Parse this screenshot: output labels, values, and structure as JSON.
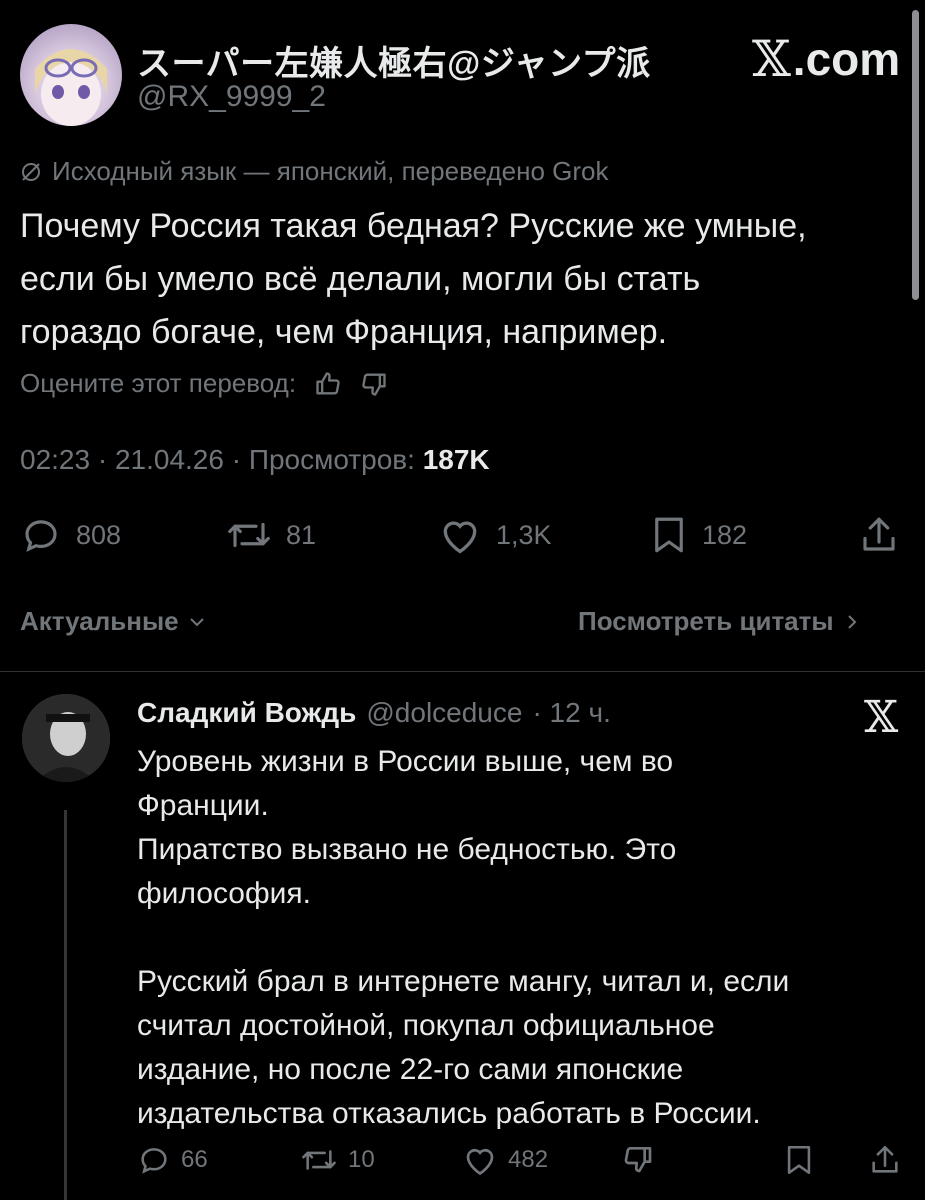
{
  "post": {
    "display_name": "スーパー左嫌人極右@ジャンプ派",
    "handle": "@RX_9999_2",
    "site_label": ".com",
    "translation_notice": "Исходный язык — японский, переведено Grok",
    "text": "Почему Россия такая бедная? Русские же умные,\nесли бы умело всё делали, могли бы стать\nгораздо богаче, чем Франция, например.",
    "rate_translation_label": "Оцените этот перевод:",
    "timestamp": "02:23 · 21.04.26 · ",
    "views_label": "Просмотров: ",
    "views_count": "187K",
    "actions": {
      "replies": "808",
      "reposts": "81",
      "likes": "1,3K",
      "bookmarks": "182"
    },
    "sort_label": "Актуальные",
    "quotes_label": "Посмотреть цитаты"
  },
  "reply": {
    "name": "Сладкий Вождь",
    "handle": "@dolceduce",
    "time": "· 12 ч.",
    "text": "Уровень жизни в России выше, чем во\nФранции.\nПиратство вызвано не бедностью. Это\nфилософия.\n\nРусский брал в интернете мангу, читал и, если\nсчитал достойной, покупал официальное\nиздание, но после 22-го сами японские\nиздательства отказались работать в России.",
    "actions": {
      "replies": "66",
      "reposts": "10",
      "likes": "482"
    }
  },
  "colors": {
    "background": "#000000",
    "text": "#e7e9ea",
    "muted": "#71767b"
  }
}
